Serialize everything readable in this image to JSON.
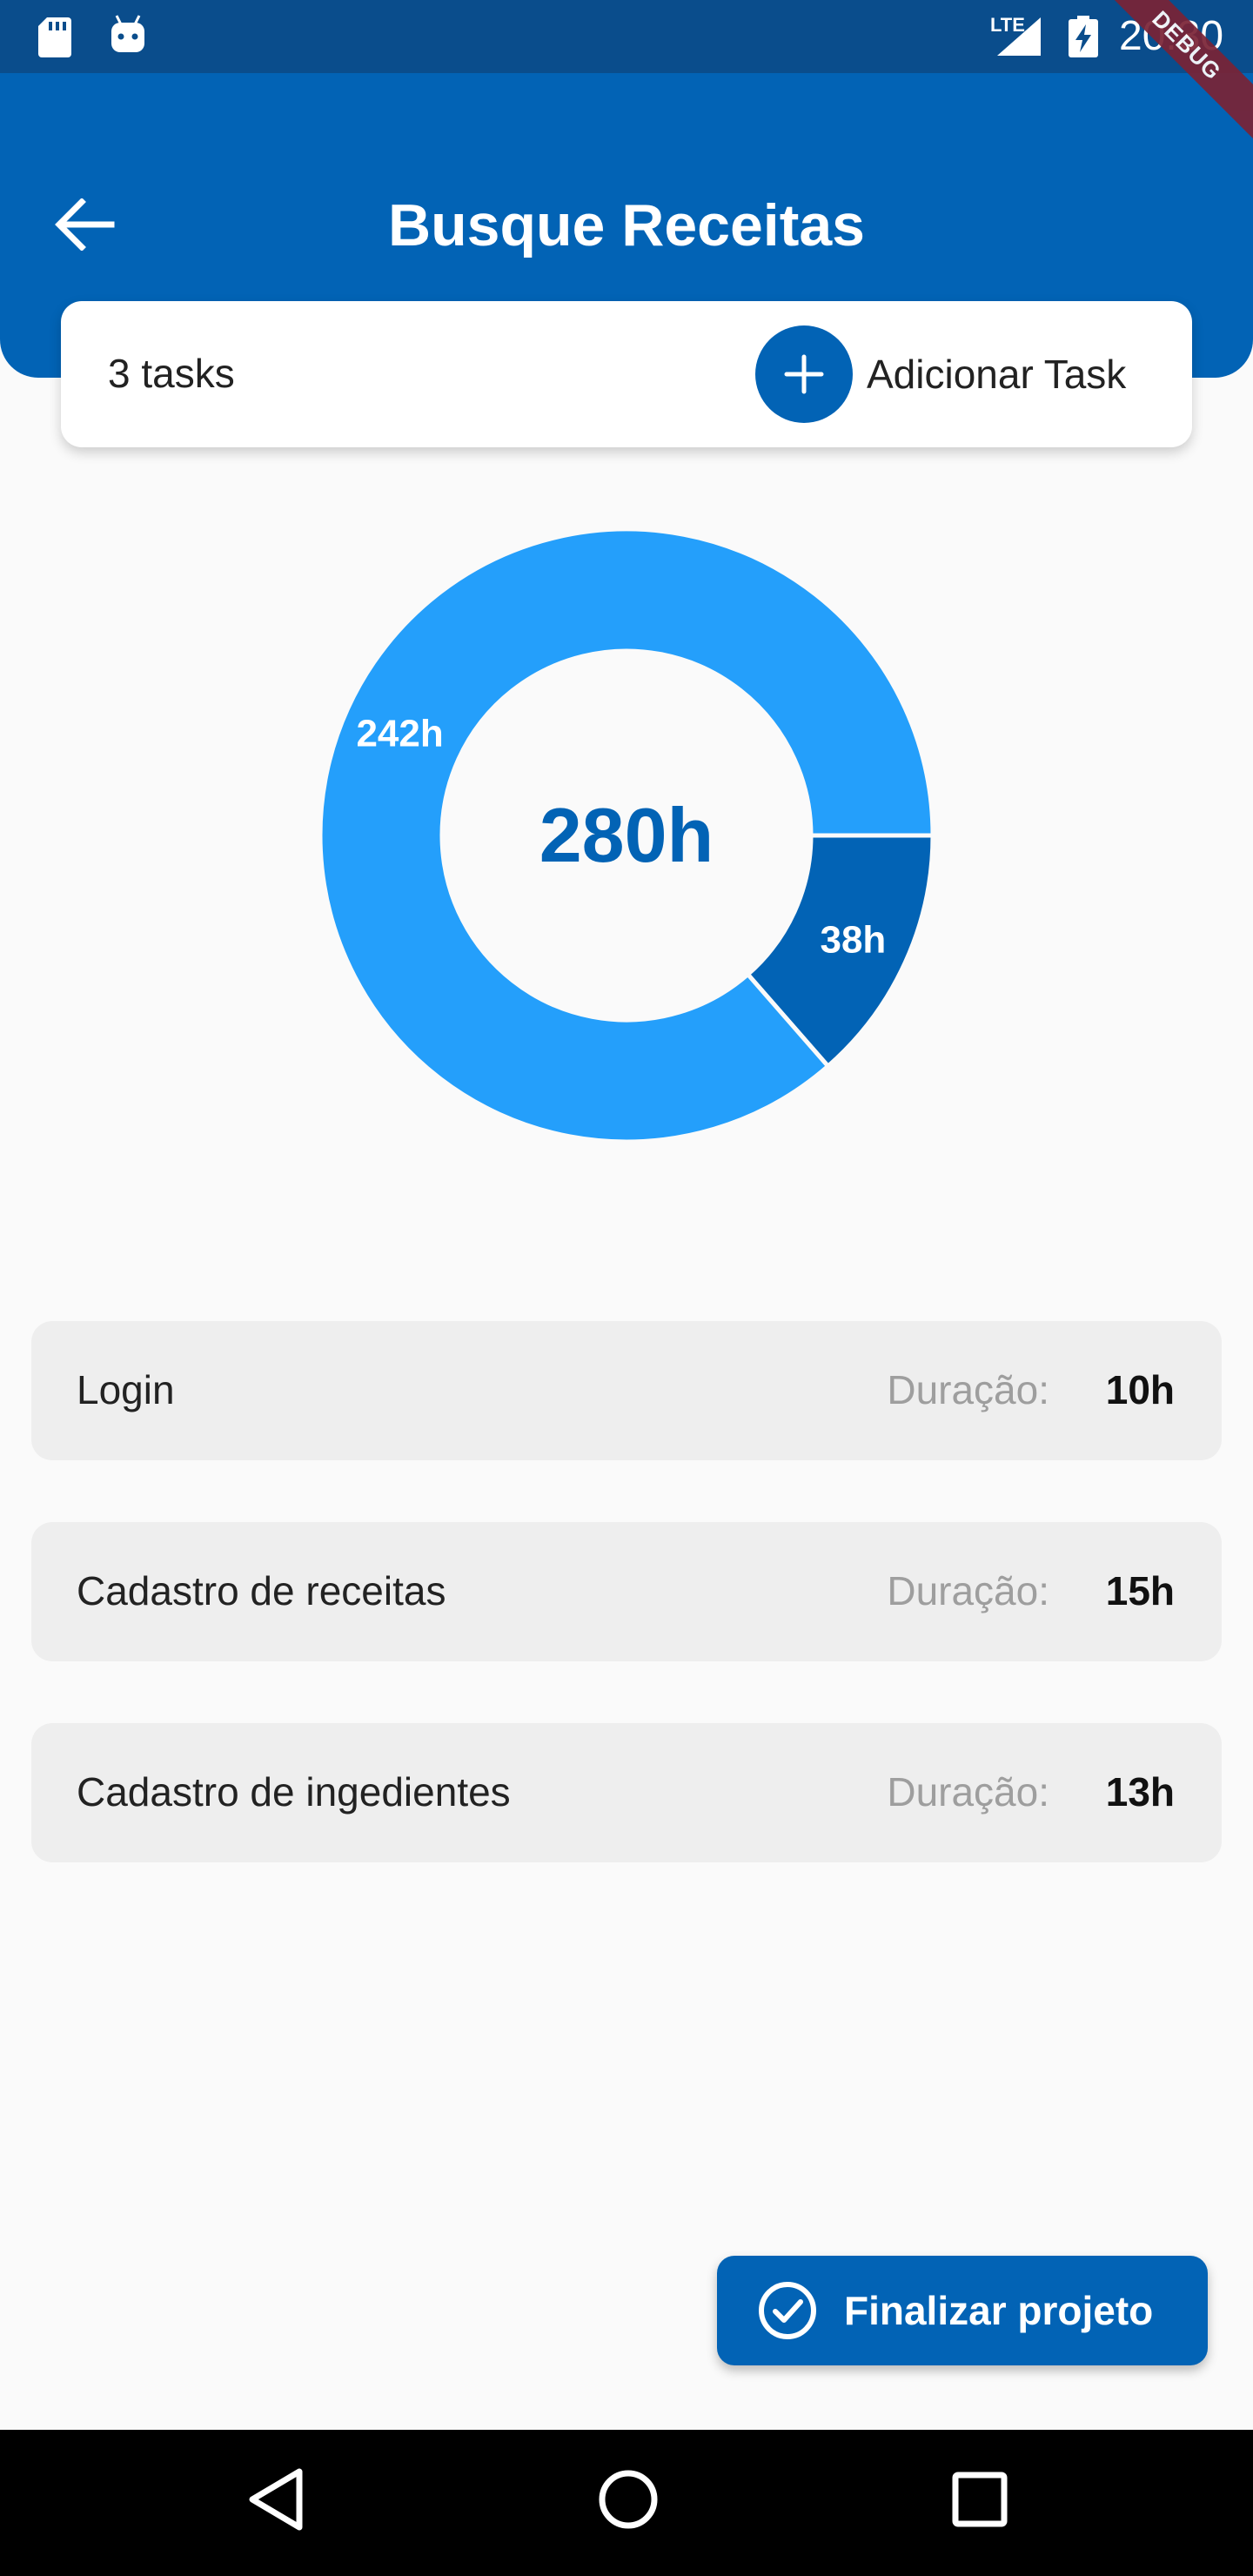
{
  "status_bar": {
    "time": "20:30",
    "network": "LTE",
    "icons": [
      "sd-card-icon",
      "android-icon",
      "signal-icon",
      "battery-charging-icon"
    ]
  },
  "debug_banner": "DEBUG",
  "header": {
    "title": "Busque Receitas",
    "back_icon": "arrow-left-icon"
  },
  "task_summary": {
    "count_label": "3 tasks",
    "add_label": "Adicionar Task",
    "add_icon": "plus-icon"
  },
  "chart_data": {
    "type": "pie",
    "donut": true,
    "center_label": "280h",
    "slices": [
      {
        "label": "242h",
        "value": 242,
        "color": "#249ffb"
      },
      {
        "label": "38h",
        "value": 38,
        "color": "#0263b5"
      }
    ]
  },
  "tasks": [
    {
      "name": "Login",
      "duration_label": "Duração:",
      "duration": "10h"
    },
    {
      "name": "Cadastro de receitas",
      "duration_label": "Duração:",
      "duration": "15h"
    },
    {
      "name": "Cadastro de ingedientes",
      "duration_label": "Duração:",
      "duration": "13h"
    }
  ],
  "finish_button": {
    "label": "Finalizar projeto",
    "icon": "check-circle-icon"
  },
  "colors": {
    "primary": "#0263b5",
    "status_bar": "#0a4d8c",
    "accent_light": "#249ffb",
    "card_bg": "#eeeeee",
    "page_bg": "#fafafa"
  }
}
